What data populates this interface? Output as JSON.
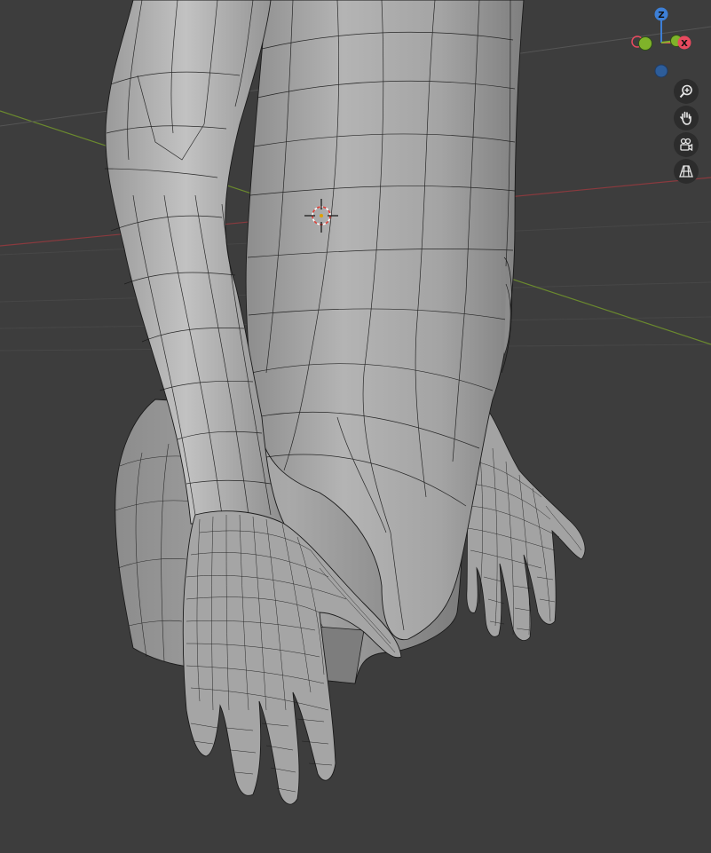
{
  "viewport": {
    "background": "#3d3d3d",
    "mesh_color": "#a9a9a9",
    "wire_color": "#1a1a1a",
    "x_axis_color": "#8a3a3e",
    "y_axis_color": "#6b8a2e"
  },
  "gizmo": {
    "z_label": "Z",
    "x_label": "X",
    "x_color": "#e84a5f",
    "y_color": "#7fb32a",
    "z_color": "#3d7fd6",
    "neg_z_color": "#2d5d9a"
  },
  "nav_buttons": [
    {
      "name": "zoom-button",
      "icon": "magnifier-plus-icon"
    },
    {
      "name": "pan-button",
      "icon": "hand-icon"
    },
    {
      "name": "camera-view-button",
      "icon": "camera-icon"
    },
    {
      "name": "perspective-toggle-button",
      "icon": "grid-icon"
    }
  ],
  "cursor3d": {
    "color": "#e0403a"
  }
}
